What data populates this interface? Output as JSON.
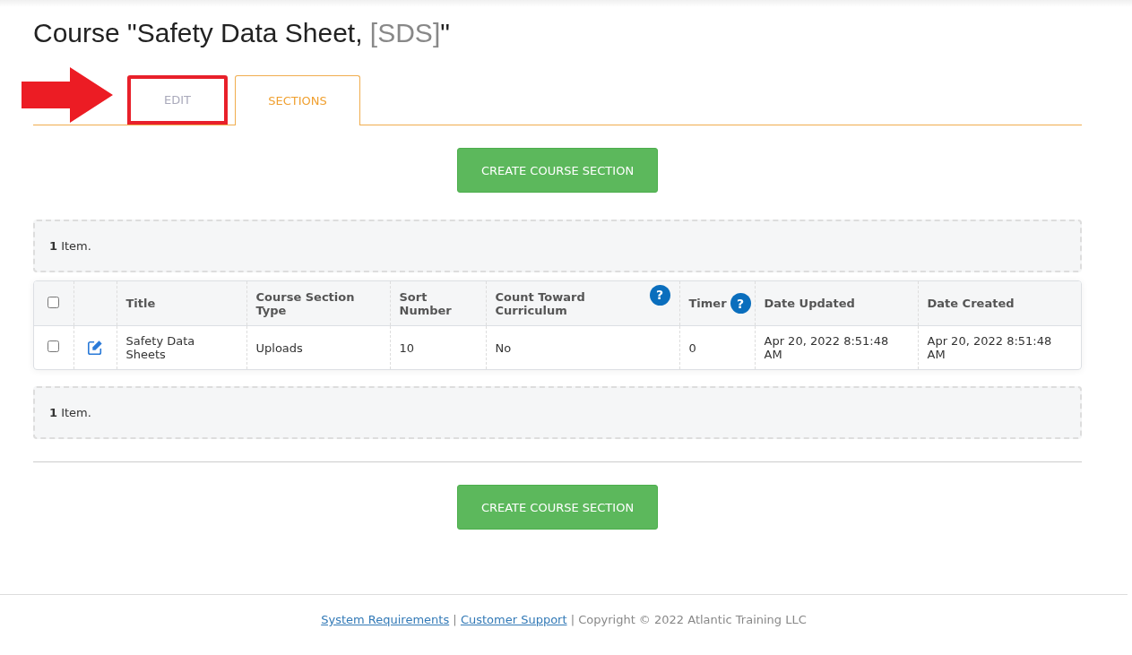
{
  "title": {
    "text": "Course \"Safety Data Sheet, ",
    "code": "[SDS]",
    "closing": "\""
  },
  "tabs": [
    {
      "label": "EDIT",
      "selected": false,
      "highlighted": true
    },
    {
      "label": "SECTIONS",
      "selected": true,
      "highlighted": false
    }
  ],
  "create_button_top": "CREATE COURSE SECTION",
  "summary_top": {
    "count": "1",
    "text": " Item."
  },
  "table": {
    "select_all": {
      "checked": false
    },
    "columns": [
      {
        "label": "Title"
      },
      {
        "label": "Course Section Type"
      },
      {
        "label": "Sort Number"
      },
      {
        "label": "Count Toward Curriculum",
        "help": "?"
      },
      {
        "label": "Timer",
        "help": "?"
      },
      {
        "label": "Date Updated"
      },
      {
        "label": "Date Created"
      }
    ],
    "rows": [
      {
        "checked": false,
        "cells": [
          "Safety Data Sheets",
          "Uploads",
          "10",
          "No",
          "0",
          "Apr 20, 2022 8:51:48 AM",
          "Apr 20, 2022 8:51:48 AM"
        ]
      }
    ]
  },
  "summary_bottom": {
    "count": "1",
    "text": " Item."
  },
  "create_button_bottom": "CREATE COURSE SECTION",
  "footer": {
    "links": [
      "System Requirements",
      "Customer Support"
    ],
    "separator": "|",
    "copyright": "Copyright © 2022 Atlantic Training LLC"
  }
}
